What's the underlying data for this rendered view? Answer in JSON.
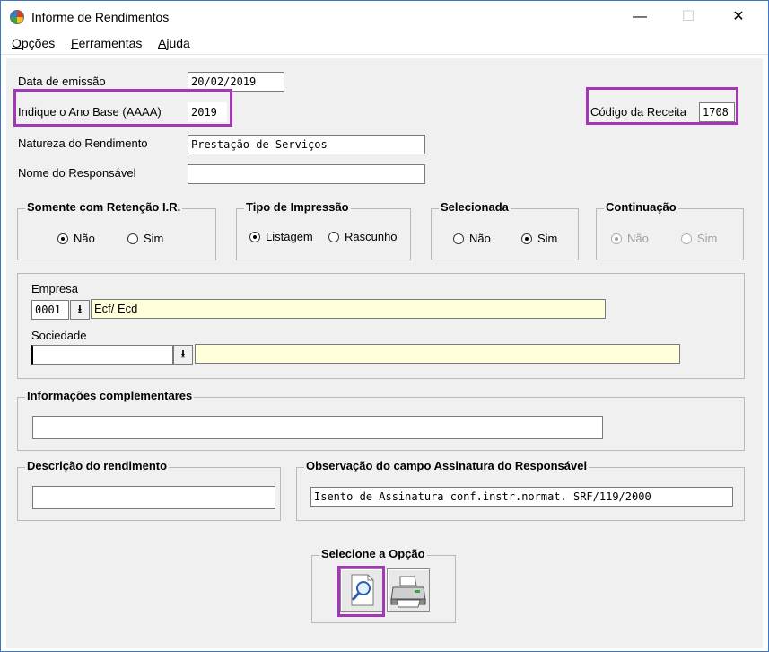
{
  "window": {
    "title": "Informe de Rendimentos",
    "min_glyph": "—",
    "max_glyph": "☐",
    "close_glyph": "✕"
  },
  "menu": [
    "Opções",
    "Ferramentas",
    "Ajuda"
  ],
  "form": {
    "data_emissao_label": "Data de emissão",
    "data_emissao_value": "20/02/2019",
    "ano_base_label": "Indique o Ano Base (AAAA)",
    "ano_base_value": "2019",
    "codigo_receita_label": "Código da Receita",
    "codigo_receita_value": "1708",
    "natureza_label": "Natureza do Rendimento",
    "natureza_value": "Prestação de Serviços",
    "responsavel_label": "Nome do Responsável",
    "responsavel_value": ""
  },
  "groups": {
    "retencao": {
      "title": "Somente com Retenção I.R.",
      "opt1": "Não",
      "opt2": "Sim",
      "selected": "Não"
    },
    "impressao": {
      "title": "Tipo de Impressão",
      "opt1": "Listagem",
      "opt2": "Rascunho",
      "selected": "Listagem"
    },
    "selecionada": {
      "title": "Selecionada",
      "opt1": "Não",
      "opt2": "Sim",
      "selected": "Sim"
    },
    "continuacao": {
      "title": "Continuação",
      "opt1": "Não",
      "opt2": "Sim",
      "selected": "Não",
      "disabled": true
    }
  },
  "empresa": {
    "label": "Empresa",
    "code": "0001",
    "name": "Ecf/ Ecd"
  },
  "sociedade": {
    "label": "Sociedade",
    "code": "",
    "name": ""
  },
  "info_complementares": {
    "title": "Informações complementares",
    "value": ""
  },
  "descricao": {
    "title": "Descrição do rendimento",
    "value": ""
  },
  "observacao": {
    "title": "Observação do campo Assinatura do Responsável",
    "value": "Isento de Assinatura conf.instr.normat. SRF/119/2000"
  },
  "opcao": {
    "title": "Selecione a Opção",
    "buttons": [
      {
        "icon": "magnifier-preview-icon"
      },
      {
        "icon": "printer-icon"
      }
    ]
  },
  "colors": {
    "highlight": "#a238b5",
    "field_yellow": "#ffffdc",
    "panel": "#f0f0f0"
  }
}
